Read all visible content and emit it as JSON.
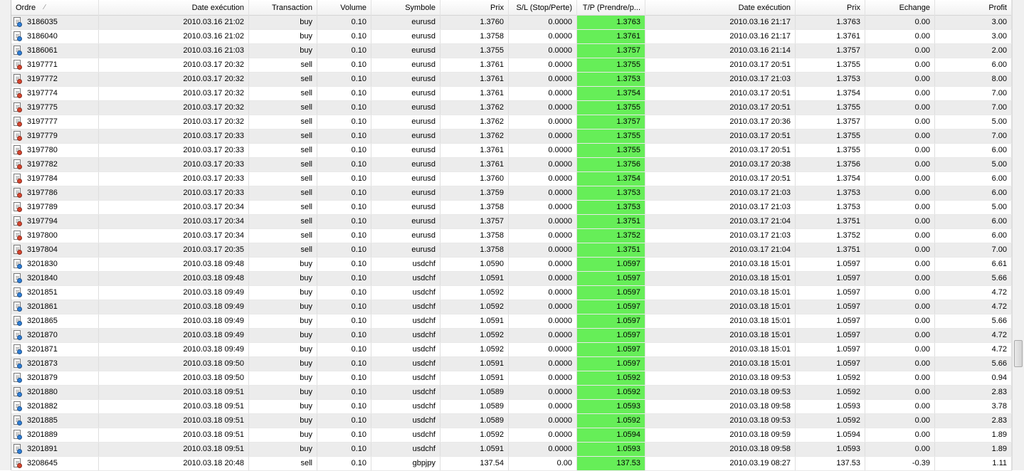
{
  "columns": [
    {
      "key": "ordre",
      "label": "Ordre",
      "width": 123
    },
    {
      "key": "date1",
      "label": "Date exécution",
      "width": 211
    },
    {
      "key": "transaction",
      "label": "Transaction",
      "width": 96
    },
    {
      "key": "volume",
      "label": "Volume",
      "width": 76
    },
    {
      "key": "symbole",
      "label": "Symbole",
      "width": 97
    },
    {
      "key": "prix1",
      "label": "Prix",
      "width": 96
    },
    {
      "key": "sl",
      "label": "S/L (Stop/Perte)",
      "width": 96
    },
    {
      "key": "tp",
      "label": "T/P (Prendre/p...",
      "width": 96
    },
    {
      "key": "date2",
      "label": "Date exécution",
      "width": 211
    },
    {
      "key": "prix2",
      "label": "Prix",
      "width": 98
    },
    {
      "key": "echange",
      "label": "Echange",
      "width": 98
    },
    {
      "key": "profit",
      "label": "Profit",
      "width": 108
    }
  ],
  "sort_indicator": "∕",
  "colors": {
    "buy": "#2f7fd8",
    "sell": "#d8452f",
    "tp_bg": "#66ee58"
  },
  "rows": [
    {
      "icon": "buy",
      "cells": [
        "3186035",
        "2010.03.16 21:02",
        "buy",
        "0.10",
        "eurusd",
        "1.3760",
        "0.0000",
        "1.3763",
        "2010.03.16 21:17",
        "1.3763",
        "0.00",
        "3.00"
      ]
    },
    {
      "icon": "buy",
      "cells": [
        "3186040",
        "2010.03.16 21:02",
        "buy",
        "0.10",
        "eurusd",
        "1.3758",
        "0.0000",
        "1.3761",
        "2010.03.16 21:17",
        "1.3761",
        "0.00",
        "3.00"
      ]
    },
    {
      "icon": "buy",
      "cells": [
        "3186061",
        "2010.03.16 21:03",
        "buy",
        "0.10",
        "eurusd",
        "1.3755",
        "0.0000",
        "1.3757",
        "2010.03.16 21:14",
        "1.3757",
        "0.00",
        "2.00"
      ]
    },
    {
      "icon": "sell",
      "cells": [
        "3197771",
        "2010.03.17 20:32",
        "sell",
        "0.10",
        "eurusd",
        "1.3761",
        "0.0000",
        "1.3755",
        "2010.03.17 20:51",
        "1.3755",
        "0.00",
        "6.00"
      ]
    },
    {
      "icon": "sell",
      "cells": [
        "3197772",
        "2010.03.17 20:32",
        "sell",
        "0.10",
        "eurusd",
        "1.3761",
        "0.0000",
        "1.3753",
        "2010.03.17 21:03",
        "1.3753",
        "0.00",
        "8.00"
      ]
    },
    {
      "icon": "sell",
      "cells": [
        "3197774",
        "2010.03.17 20:32",
        "sell",
        "0.10",
        "eurusd",
        "1.3761",
        "0.0000",
        "1.3754",
        "2010.03.17 20:51",
        "1.3754",
        "0.00",
        "7.00"
      ]
    },
    {
      "icon": "sell",
      "cells": [
        "3197775",
        "2010.03.17 20:32",
        "sell",
        "0.10",
        "eurusd",
        "1.3762",
        "0.0000",
        "1.3755",
        "2010.03.17 20:51",
        "1.3755",
        "0.00",
        "7.00"
      ]
    },
    {
      "icon": "sell",
      "cells": [
        "3197777",
        "2010.03.17 20:32",
        "sell",
        "0.10",
        "eurusd",
        "1.3762",
        "0.0000",
        "1.3757",
        "2010.03.17 20:36",
        "1.3757",
        "0.00",
        "5.00"
      ]
    },
    {
      "icon": "sell",
      "cells": [
        "3197779",
        "2010.03.17 20:33",
        "sell",
        "0.10",
        "eurusd",
        "1.3762",
        "0.0000",
        "1.3755",
        "2010.03.17 20:51",
        "1.3755",
        "0.00",
        "7.00"
      ]
    },
    {
      "icon": "sell",
      "cells": [
        "3197780",
        "2010.03.17 20:33",
        "sell",
        "0.10",
        "eurusd",
        "1.3761",
        "0.0000",
        "1.3755",
        "2010.03.17 20:51",
        "1.3755",
        "0.00",
        "6.00"
      ]
    },
    {
      "icon": "sell",
      "cells": [
        "3197782",
        "2010.03.17 20:33",
        "sell",
        "0.10",
        "eurusd",
        "1.3761",
        "0.0000",
        "1.3756",
        "2010.03.17 20:38",
        "1.3756",
        "0.00",
        "5.00"
      ]
    },
    {
      "icon": "sell",
      "cells": [
        "3197784",
        "2010.03.17 20:33",
        "sell",
        "0.10",
        "eurusd",
        "1.3760",
        "0.0000",
        "1.3754",
        "2010.03.17 20:51",
        "1.3754",
        "0.00",
        "6.00"
      ]
    },
    {
      "icon": "sell",
      "cells": [
        "3197786",
        "2010.03.17 20:33",
        "sell",
        "0.10",
        "eurusd",
        "1.3759",
        "0.0000",
        "1.3753",
        "2010.03.17 21:03",
        "1.3753",
        "0.00",
        "6.00"
      ]
    },
    {
      "icon": "sell",
      "cells": [
        "3197789",
        "2010.03.17 20:34",
        "sell",
        "0.10",
        "eurusd",
        "1.3758",
        "0.0000",
        "1.3753",
        "2010.03.17 21:03",
        "1.3753",
        "0.00",
        "5.00"
      ]
    },
    {
      "icon": "sell",
      "cells": [
        "3197794",
        "2010.03.17 20:34",
        "sell",
        "0.10",
        "eurusd",
        "1.3757",
        "0.0000",
        "1.3751",
        "2010.03.17 21:04",
        "1.3751",
        "0.00",
        "6.00"
      ]
    },
    {
      "icon": "sell",
      "cells": [
        "3197800",
        "2010.03.17 20:34",
        "sell",
        "0.10",
        "eurusd",
        "1.3758",
        "0.0000",
        "1.3752",
        "2010.03.17 21:03",
        "1.3752",
        "0.00",
        "6.00"
      ]
    },
    {
      "icon": "sell",
      "cells": [
        "3197804",
        "2010.03.17 20:35",
        "sell",
        "0.10",
        "eurusd",
        "1.3758",
        "0.0000",
        "1.3751",
        "2010.03.17 21:04",
        "1.3751",
        "0.00",
        "7.00"
      ]
    },
    {
      "icon": "buy",
      "cells": [
        "3201830",
        "2010.03.18 09:48",
        "buy",
        "0.10",
        "usdchf",
        "1.0590",
        "0.0000",
        "1.0597",
        "2010.03.18 15:01",
        "1.0597",
        "0.00",
        "6.61"
      ]
    },
    {
      "icon": "buy",
      "cells": [
        "3201840",
        "2010.03.18 09:48",
        "buy",
        "0.10",
        "usdchf",
        "1.0591",
        "0.0000",
        "1.0597",
        "2010.03.18 15:01",
        "1.0597",
        "0.00",
        "5.66"
      ]
    },
    {
      "icon": "buy",
      "cells": [
        "3201851",
        "2010.03.18 09:49",
        "buy",
        "0.10",
        "usdchf",
        "1.0592",
        "0.0000",
        "1.0597",
        "2010.03.18 15:01",
        "1.0597",
        "0.00",
        "4.72"
      ]
    },
    {
      "icon": "buy",
      "cells": [
        "3201861",
        "2010.03.18 09:49",
        "buy",
        "0.10",
        "usdchf",
        "1.0592",
        "0.0000",
        "1.0597",
        "2010.03.18 15:01",
        "1.0597",
        "0.00",
        "4.72"
      ]
    },
    {
      "icon": "buy",
      "cells": [
        "3201865",
        "2010.03.18 09:49",
        "buy",
        "0.10",
        "usdchf",
        "1.0591",
        "0.0000",
        "1.0597",
        "2010.03.18 15:01",
        "1.0597",
        "0.00",
        "5.66"
      ]
    },
    {
      "icon": "buy",
      "cells": [
        "3201870",
        "2010.03.18 09:49",
        "buy",
        "0.10",
        "usdchf",
        "1.0592",
        "0.0000",
        "1.0597",
        "2010.03.18 15:01",
        "1.0597",
        "0.00",
        "4.72"
      ]
    },
    {
      "icon": "buy",
      "cells": [
        "3201871",
        "2010.03.18 09:49",
        "buy",
        "0.10",
        "usdchf",
        "1.0592",
        "0.0000",
        "1.0597",
        "2010.03.18 15:01",
        "1.0597",
        "0.00",
        "4.72"
      ]
    },
    {
      "icon": "buy",
      "cells": [
        "3201873",
        "2010.03.18 09:50",
        "buy",
        "0.10",
        "usdchf",
        "1.0591",
        "0.0000",
        "1.0597",
        "2010.03.18 15:01",
        "1.0597",
        "0.00",
        "5.66"
      ]
    },
    {
      "icon": "buy",
      "cells": [
        "3201879",
        "2010.03.18 09:50",
        "buy",
        "0.10",
        "usdchf",
        "1.0591",
        "0.0000",
        "1.0592",
        "2010.03.18 09:53",
        "1.0592",
        "0.00",
        "0.94"
      ]
    },
    {
      "icon": "buy",
      "cells": [
        "3201880",
        "2010.03.18 09:51",
        "buy",
        "0.10",
        "usdchf",
        "1.0589",
        "0.0000",
        "1.0592",
        "2010.03.18 09:53",
        "1.0592",
        "0.00",
        "2.83"
      ]
    },
    {
      "icon": "buy",
      "cells": [
        "3201882",
        "2010.03.18 09:51",
        "buy",
        "0.10",
        "usdchf",
        "1.0589",
        "0.0000",
        "1.0593",
        "2010.03.18 09:58",
        "1.0593",
        "0.00",
        "3.78"
      ]
    },
    {
      "icon": "buy",
      "cells": [
        "3201885",
        "2010.03.18 09:51",
        "buy",
        "0.10",
        "usdchf",
        "1.0589",
        "0.0000",
        "1.0592",
        "2010.03.18 09:53",
        "1.0592",
        "0.00",
        "2.83"
      ]
    },
    {
      "icon": "buy",
      "cells": [
        "3201889",
        "2010.03.18 09:51",
        "buy",
        "0.10",
        "usdchf",
        "1.0592",
        "0.0000",
        "1.0594",
        "2010.03.18 09:59",
        "1.0594",
        "0.00",
        "1.89"
      ]
    },
    {
      "icon": "buy",
      "cells": [
        "3201891",
        "2010.03.18 09:51",
        "buy",
        "0.10",
        "usdchf",
        "1.0591",
        "0.0000",
        "1.0593",
        "2010.03.18 09:58",
        "1.0593",
        "0.00",
        "1.89"
      ]
    },
    {
      "icon": "sell",
      "cells": [
        "3208645",
        "2010.03.18 20:48",
        "sell",
        "0.10",
        "gbpjpy",
        "137.54",
        "0.00",
        "137.53",
        "2010.03.19 08:27",
        "137.53",
        "-0.39",
        "1.11"
      ]
    }
  ]
}
